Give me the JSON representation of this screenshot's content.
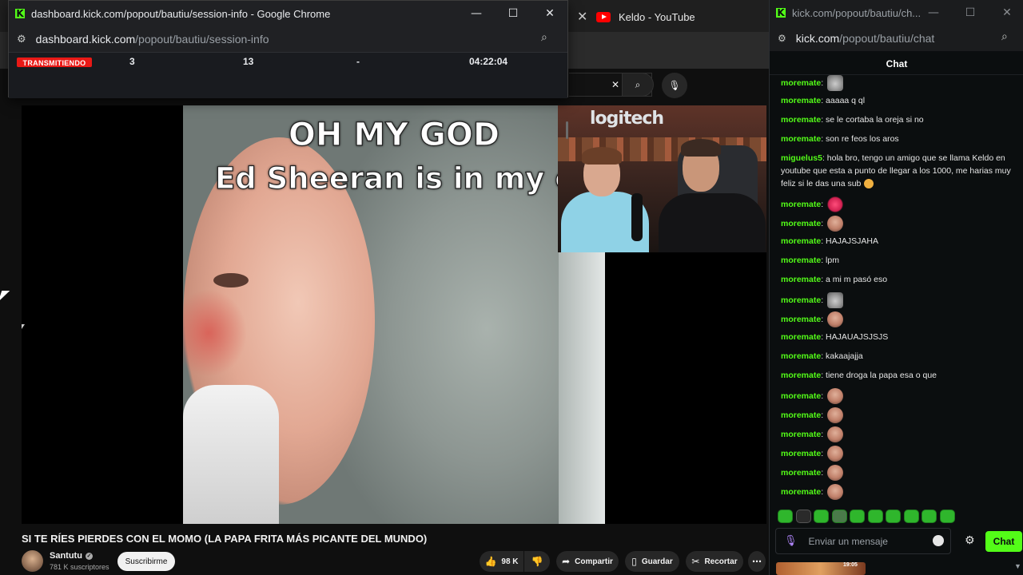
{
  "youtube": {
    "tab_title": "Keldo - YouTube",
    "video": {
      "meme_line1": "OH MY GOD",
      "meme_line2": "Ed Sheeran is in my ca",
      "webcam_banner": "logitech"
    },
    "title": "SI TE RÍES PIERDES CON EL MOMO (LA PAPA FRITA MÁS PICANTE DEL MUNDO)",
    "channel": {
      "name": "Santutu",
      "subscribers": "781 K suscriptores"
    },
    "subscribe_label": "Suscribirme",
    "actions": {
      "likes": "98 K",
      "share": "Compartir",
      "save": "Guardar",
      "clip": "Recortar"
    }
  },
  "dashboard_window": {
    "title": "dashboard.kick.com/popout/bautiu/session-info - Google Chrome",
    "url_host": "dashboard.kick.com",
    "url_path": "/popout/bautiu/session-info",
    "status": "TRANSMITIENDO",
    "stats": {
      "viewers": "3",
      "followers": "13",
      "other": "-",
      "duration": "04:22:04"
    }
  },
  "chat_window": {
    "title": "kick.com/popout/bautiu/ch...",
    "url_host": "kick.com",
    "url_path": "/popout/bautiu/chat",
    "header": "Chat",
    "messages": [
      {
        "user": "moremate",
        "text": ""
      },
      {
        "user": "moremate",
        "text": "aaaaa q ql"
      },
      {
        "user": "moremate",
        "text": "se le cortaba la oreja si no"
      },
      {
        "user": "moremate",
        "text": "son re feos los aros"
      },
      {
        "user": "miguelus5",
        "text": "hola bro, tengo un amigo que se llama Keldo en youtube que esta a punto de llegar a los 1000, me harias muy feliz si le das una sub"
      },
      {
        "user": "moremate",
        "text": ""
      },
      {
        "user": "moremate",
        "text": ""
      },
      {
        "user": "moremate",
        "text": "HAJAJSJAHA"
      },
      {
        "user": "moremate",
        "text": "lpm"
      },
      {
        "user": "moremate",
        "text": "a mi m pasó eso"
      },
      {
        "user": "moremate",
        "text": ""
      },
      {
        "user": "moremate",
        "text": ""
      },
      {
        "user": "moremate",
        "text": "HAJAUAJSJSJS"
      },
      {
        "user": "moremate",
        "text": "kakaajajja"
      },
      {
        "user": "moremate",
        "text": "tiene droga la papa esa o que"
      },
      {
        "user": "moremate",
        "text": ""
      },
      {
        "user": "moremate",
        "text": ""
      },
      {
        "user": "moremate",
        "text": ""
      },
      {
        "user": "moremate",
        "text": ""
      },
      {
        "user": "moremate",
        "text": ""
      },
      {
        "user": "moremate",
        "text": ""
      }
    ],
    "input_placeholder": "Enviar un mensaje",
    "send_label": "Chat",
    "bottom_label": "19:05"
  },
  "colors": {
    "kick_green": "#53fc18",
    "live_red": "#e91916",
    "youtube_red": "#ff0000"
  }
}
